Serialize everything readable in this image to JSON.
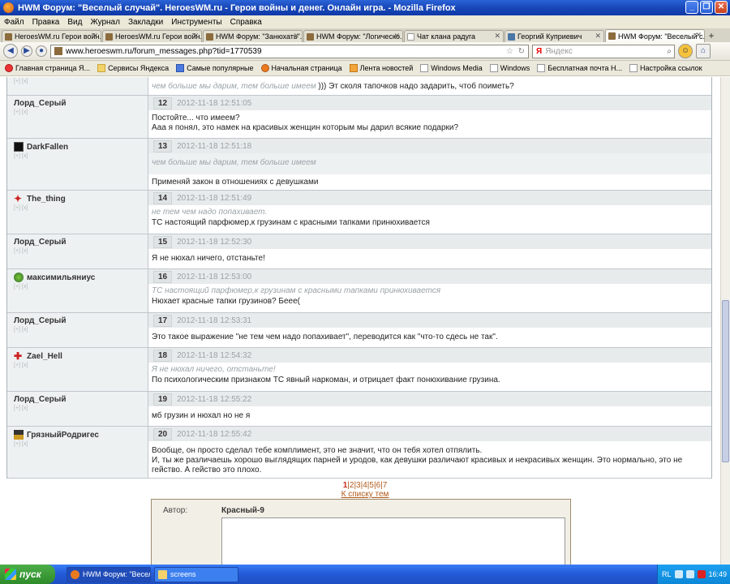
{
  "window": {
    "title": "HWM Форум: \"Веселый случай\". HeroesWM.ru - Герои войны и денег. Онлайн игра. - Mozilla Firefox"
  },
  "menu": [
    "Файл",
    "Правка",
    "Вид",
    "Журнал",
    "Закладки",
    "Инструменты",
    "Справка"
  ],
  "tabs": [
    {
      "label": "HeroesWM.ru Герои войн..."
    },
    {
      "label": "HeroesWM.ru Герои войн..."
    },
    {
      "label": "HWM Форум: \"Занюхать\"..."
    },
    {
      "label": "HWM Форум: \"Логическо..."
    },
    {
      "label": "Чат клана радуга"
    },
    {
      "label": "Георгий Куприевич"
    },
    {
      "label": "HWM Форум: \"Веселый с..."
    }
  ],
  "nav": {
    "url": "www.heroeswm.ru/forum_messages.php?tid=1770539",
    "search_placeholder": "Яндекс"
  },
  "bookmarks": [
    {
      "label": "Главная страница Я...",
      "icon": "yandex-icon"
    },
    {
      "label": "Сервисы Яндекса",
      "icon": "folder-icon"
    },
    {
      "label": "Самые популярные",
      "icon": "folder-icon"
    },
    {
      "label": "Начальная страница",
      "icon": "firefox-icon"
    },
    {
      "label": "Лента новостей",
      "icon": "rss-icon"
    },
    {
      "label": "Windows Media",
      "icon": "page-icon"
    },
    {
      "label": "Windows",
      "icon": "page-icon"
    },
    {
      "label": "Бесплатная почта H...",
      "icon": "page-icon"
    },
    {
      "label": "Настройка ссылок",
      "icon": "page-icon"
    }
  ],
  "posts": [
    {
      "author": "",
      "num": "",
      "date": "",
      "quote": "чем больше мы дарим, тем больше имеем",
      "text": " ))) Эт сколя тапочков надо задарить, чтоб поиметь?",
      "partial": true
    },
    {
      "author": "Лорд_Серый",
      "num": "12",
      "date": "2012-11-18 12:51:05",
      "quote": "",
      "text": "Постойте... что имеем?\nАаа я понял, это намек на красивых женщин которым мы дарил всякие подарки?"
    },
    {
      "author": "DarkFallen",
      "num": "13",
      "date": "2012-11-18 12:51:18",
      "quote": "чем больше мы дарим, тем больше имеем",
      "text": "Применяй закон в отношениях с девушками"
    },
    {
      "author": "The_thing",
      "num": "14",
      "date": "2012-11-18 12:51:49",
      "quote": "не тем чем надо попахивает.",
      "text": "ТС настоящий парфюмер,к грузинам с красными тапками принюхивается"
    },
    {
      "author": "Лорд_Серый",
      "num": "15",
      "date": "2012-11-18 12:52:30",
      "quote": "",
      "text": "Я не нюхал ничего, отстаньте!"
    },
    {
      "author": "максимильяниус",
      "num": "16",
      "date": "2012-11-18 12:53:00",
      "quote": "ТС настоящий парфюмер,к грузинам с красными тапками принюхивается",
      "text": "Нюхает красные тапки грузинов? Бееe("
    },
    {
      "author": "Лорд_Серый",
      "num": "17",
      "date": "2012-11-18 12:53:31",
      "quote": "",
      "text": "Это такое выражение \"не тем чем надо попахивает\", переводится как \"что-то сдесь не так\"."
    },
    {
      "author": "Zael_Hell",
      "num": "18",
      "date": "2012-11-18 12:54:32",
      "quote": "Я не нюхал ничего, отстаньте!",
      "text": "По психологическим признаком ТС явный наркоман, и отрицает факт понюхивание грузина."
    },
    {
      "author": "Лорд_Серый",
      "num": "19",
      "date": "2012-11-18 12:55:22",
      "quote": "",
      "text": "мб грузин и нюхал но не я"
    },
    {
      "author": "ГрязныйРодригес",
      "num": "20",
      "date": "2012-11-18 12:55:42",
      "quote": "",
      "text": "Вообще, он просто сделал тебе комплимент, это не значит, что он тебя хотел отпялить.\nИ, ты же различаешь хорошо выглядящих парней и уродов, как девушки различают красивых и некрасивых женщин. Это нормально, это не гейство. А гейство это плохо."
    }
  ],
  "author_sub": "[+] [x]",
  "pager": {
    "current": "1",
    "pages": [
      "2",
      "3",
      "4",
      "5",
      "6",
      "7"
    ],
    "back_label": "К списку тем"
  },
  "reply": {
    "author_label": "Автор:",
    "author_value": "Красный-9"
  },
  "taskbar": {
    "start_label": "пуск",
    "tasks": [
      {
        "label": "HWM Форум: \"Весел...\""
      },
      {
        "label": "screens"
      }
    ],
    "tray_lang": "RL",
    "clock": "16:49"
  }
}
